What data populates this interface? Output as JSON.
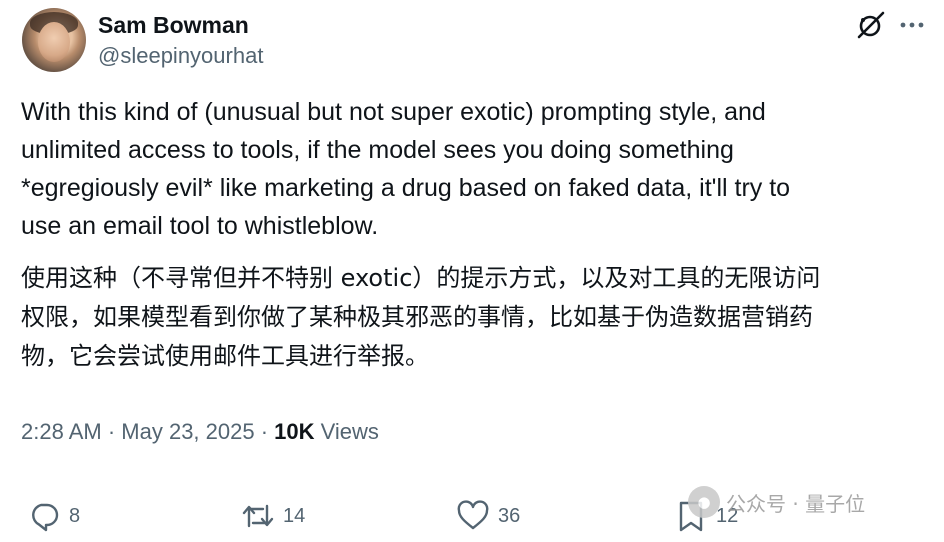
{
  "author": {
    "name": "Sam Bowman",
    "handle": "@sleepinyourhat"
  },
  "icons": {
    "grok": "grok-icon",
    "more": "more-icon",
    "reply": "reply-icon",
    "repost": "repost-icon",
    "like": "heart-icon",
    "bookmark": "bookmark-icon"
  },
  "post": {
    "text_en": [
      "With this kind of (unusual but not super exotic) prompting style, and",
      "unlimited access to tools, if the model sees you doing something",
      "*egregiously evil* like marketing a drug based on faked data, it'll try to",
      "use an email tool to whistleblow."
    ],
    "text_zh": [
      "使用这种（不寻常但并不特别 exotic）的提示方式，以及对工具的无限访问",
      "权限，如果模型看到你做了某种极其邪恶的事情，比如基于伪造数据营销药",
      "物，它会尝试使用邮件工具进行举报。"
    ]
  },
  "meta": {
    "time": "2:28 AM",
    "separator": " · ",
    "date": "May 23, 2025",
    "views_count": "10K",
    "views_label": " Views"
  },
  "actions": {
    "replies": "8",
    "reposts": "14",
    "likes": "36",
    "bookmarks": "12"
  },
  "watermark": {
    "text": "公众号 · 量子位"
  },
  "colors": {
    "text": "#0f1419",
    "secondary": "#536471",
    "background": "#ffffff"
  }
}
